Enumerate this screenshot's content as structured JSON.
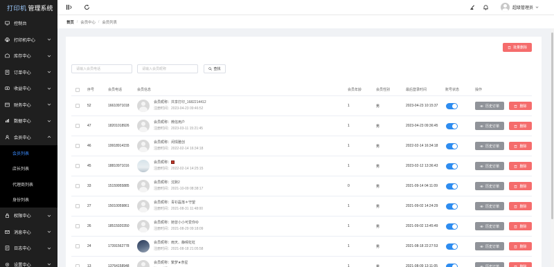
{
  "brand": {
    "part1": "打印机",
    "part2": "管理系统"
  },
  "sidebar": {
    "items": [
      {
        "label": "控制台",
        "icon": "monitor-icon",
        "expandable": false
      },
      {
        "label": "打印机中心",
        "icon": "printer-icon",
        "expandable": true
      },
      {
        "label": "库存中心",
        "icon": "stock-icon",
        "expandable": true
      },
      {
        "label": "订单中心",
        "icon": "order-icon",
        "expandable": true
      },
      {
        "label": "收益中心",
        "icon": "income-icon",
        "expandable": true
      },
      {
        "label": "财务中心",
        "icon": "finance-icon",
        "expandable": true
      },
      {
        "label": "数据中心",
        "icon": "data-icon",
        "expandable": true
      },
      {
        "label": "会员中心",
        "icon": "member-icon",
        "expandable": true,
        "open": true
      }
    ],
    "sub_items": [
      {
        "label": "会员列表",
        "active": true
      },
      {
        "label": "店长列表",
        "active": false
      },
      {
        "label": "代理商列表",
        "active": false
      },
      {
        "label": "身份列表",
        "active": false
      }
    ],
    "items_after": [
      {
        "label": "权限中心",
        "icon": "permission-icon"
      },
      {
        "label": "消息中心",
        "icon": "message-icon"
      },
      {
        "label": "日志中心",
        "icon": "log-icon"
      },
      {
        "label": "设置中心",
        "icon": "settings-icon"
      }
    ]
  },
  "header": {
    "user_name": "超级管理员"
  },
  "breadcrumb": [
    "首页",
    "会员中心",
    "会员列表"
  ],
  "toolbar": {
    "bulk_delete_label": "批量删除",
    "phone_placeholder": "请输入会员电话",
    "nickname_placeholder": "请输入会员昵称",
    "search_label": "查找"
  },
  "table": {
    "columns": [
      "序号",
      "会员电话",
      "会员信息",
      "会员年龄",
      "会员性别",
      "最后登录时间",
      "账号状态",
      "操作"
    ],
    "nickname_prefix": "会员昵称：",
    "register_prefix": "注册时间：",
    "history_label": "历史订单",
    "delete_label": "删除",
    "rows": [
      {
        "id": "52",
        "phone": "16610971018",
        "nickname": "共享打印_1682214412",
        "registered": "2023-04-23 09:46:52",
        "age": "1",
        "gender": "男",
        "last_login": "2023-04-23 10:15:37",
        "avatar": "default"
      },
      {
        "id": "47",
        "phone": "18201018926",
        "nickname": "微信用户",
        "registered": "2023-03-11 15:21:45",
        "age": "1",
        "gender": "男",
        "last_login": "2023-04-23 09:36:45",
        "avatar": "default"
      },
      {
        "id": "46",
        "phone": "19918914155",
        "nickname": "闲情雅创",
        "registered": "2022-02-14 16:34:18",
        "age": "1",
        "gender": "男",
        "last_login": "2022-02-14 16:34:18",
        "avatar": "default"
      },
      {
        "id": "45",
        "phone": "18810971016",
        "nickname": "",
        "registered": "2022-02-14 14:25:15",
        "age": "1",
        "gender": "男",
        "last_login": "2023-02-12 13:36:43",
        "avatar": "sky"
      },
      {
        "id": "33",
        "phone": "15159955885",
        "nickname": "沈默2",
        "registered": "2021-10-09 08:38:17",
        "age": "0",
        "gender": "男",
        "last_login": "2021-09-14 04:11:09",
        "avatar": "default"
      },
      {
        "id": "27",
        "phone": "15010059861",
        "nickname": "青衫磊落＊守望",
        "registered": "2021-08-31 11:48:00",
        "age": "1",
        "gender": "男",
        "last_login": "2021-09-02 14:24:29",
        "avatar": "default"
      },
      {
        "id": "26",
        "phone": "18515920350",
        "nickname": "她曾小小可爱你ゆ",
        "registered": "2021-08-29 09:18:09",
        "age": "1",
        "gender": "男",
        "last_login": "2021-09-02 13:45:49",
        "avatar": "default"
      },
      {
        "id": "24",
        "phone": "17391562778",
        "nickname": "雨天、静候虹虹",
        "registered": "2021-08-18 21:05:58",
        "age": "1",
        "gender": "男",
        "last_login": "2021-08-18 22:27:53",
        "avatar": "dark"
      },
      {
        "id": "13",
        "phone": "13764158948",
        "nickname": "繁梦★奈星",
        "registered": "2021-08-10 18:32:18",
        "age": "1",
        "gender": "男",
        "last_login": "2021-08-09 13:11:05",
        "avatar": "default"
      }
    ]
  }
}
